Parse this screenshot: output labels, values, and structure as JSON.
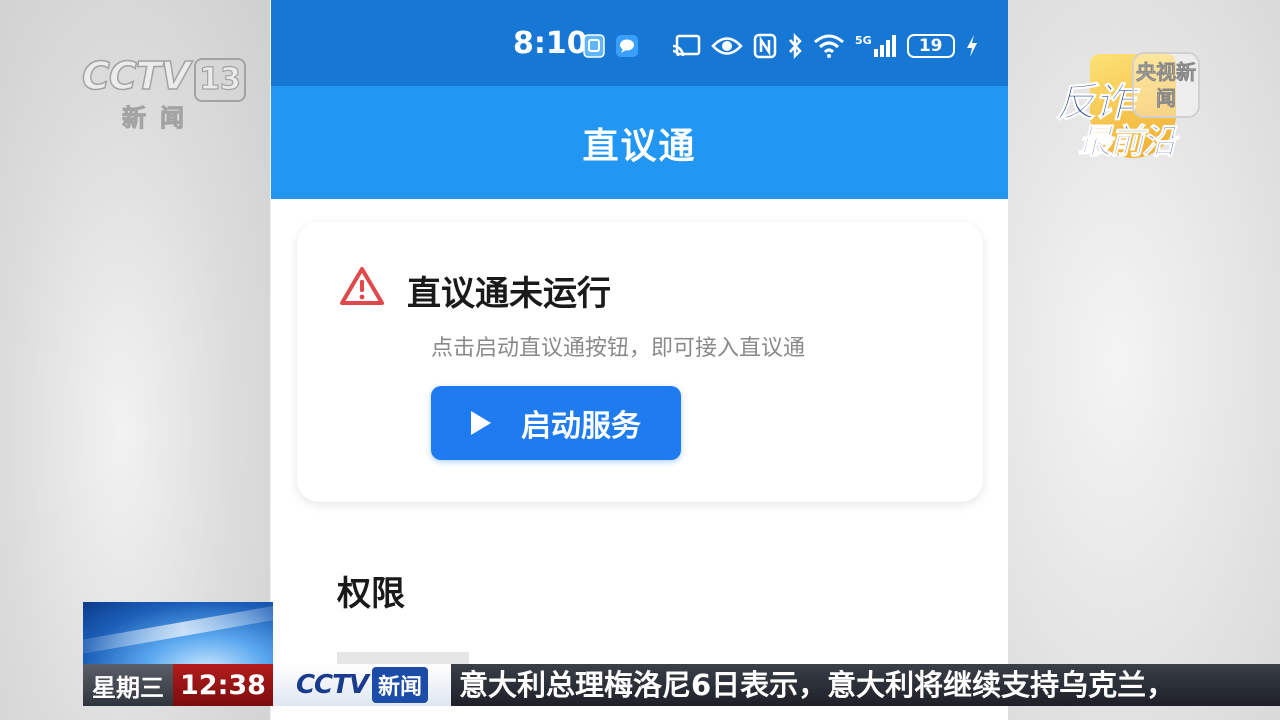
{
  "status_bar": {
    "time": "8:10",
    "network": "5G",
    "battery": "19",
    "icons": [
      "app-notification-icon",
      "message-icon",
      "cast-icon",
      "eye-comfort-icon",
      "nfc-icon",
      "bluetooth-icon",
      "wifi-icon",
      "signal-icon",
      "battery-icon",
      "charging-icon"
    ]
  },
  "app_bar": {
    "title": "直议通"
  },
  "status_card": {
    "icon": "warning-icon",
    "title": "直议通未运行",
    "subtitle": "点击启动直议通按钮，即可接入直议通",
    "button_label": "启动服务"
  },
  "permissions": {
    "section_title": "权限"
  },
  "broadcast": {
    "channel_logo": "CCTV",
    "channel_number": "13",
    "channel_sub": "新闻",
    "program_logo_line1": "反诈",
    "program_logo_line2": "最前沿",
    "program_badge": "央视新闻",
    "ticker_day": "星期三",
    "ticker_time": "12:38",
    "ticker_brand": "CCTV",
    "ticker_brand_tag": "新闻",
    "ticker_text": "意大利总理梅洛尼6日表示，意大利将继续支持乌克兰，"
  },
  "colors": {
    "status_bar": "#1677d4",
    "app_bar": "#2196f3",
    "button": "#1e7cf0",
    "warning": "#e0484a"
  }
}
